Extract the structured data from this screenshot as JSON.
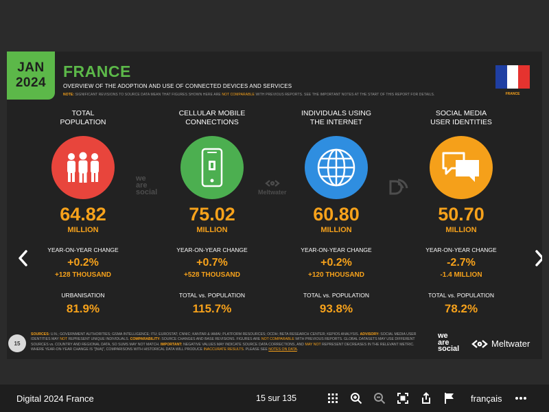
{
  "slide": {
    "date_badge": {
      "month": "JAN",
      "year": "2024"
    },
    "title": "FRANCE",
    "subtitle": "OVERVIEW OF THE ADOPTION AND USE OF CONNECTED DEVICES AND SERVICES",
    "note": {
      "label": "NOTE:",
      "text1": " SIGNIFICANT REVISIONS TO SOURCE DATA MEAN THAT FIGURES SHOWN HERE ARE ",
      "highlight": "NOT COMPARABLE",
      "text2": " WITH PREVIOUS REPORTS. SEE THE IMPORTANT NOTES AT THE START OF THIS REPORT FOR DETAILS."
    },
    "flag_label": "FRANCE",
    "colors": {
      "accent_orange": "#f7a21b",
      "accent_green": "#5cb849"
    },
    "columns": [
      {
        "heading": "TOTAL\nPOPULATION",
        "icon": "people-icon",
        "color": "#e8453c",
        "value": "64.82",
        "unit": "MILLION",
        "change_label": "YEAR-ON-YEAR CHANGE",
        "change_pct": "+0.2%",
        "change_abs": "+128 THOUSAND",
        "secondary_label": "URBANISATION",
        "secondary_value": "81.9%"
      },
      {
        "heading": "CELLULAR MOBILE\nCONNECTIONS",
        "icon": "mobile-phone-icon",
        "color": "#4caf50",
        "value": "75.02",
        "unit": "MILLION",
        "change_label": "YEAR-ON-YEAR CHANGE",
        "change_pct": "+0.7%",
        "change_abs": "+528 THOUSAND",
        "secondary_label": "TOTAL vs. POPULATION",
        "secondary_value": "115.7%"
      },
      {
        "heading": "INDIVIDUALS USING\nTHE INTERNET",
        "icon": "globe-icon",
        "color": "#2f8ee0",
        "value": "60.80",
        "unit": "MILLION",
        "change_label": "YEAR-ON-YEAR CHANGE",
        "change_pct": "+0.2%",
        "change_abs": "+120 THOUSAND",
        "secondary_label": "TOTAL vs. POPULATION",
        "secondary_value": "93.8%"
      },
      {
        "heading": "SOCIAL MEDIA\nUSER IDENTITIES",
        "icon": "speech-bubbles-icon",
        "color": "#f5a01a",
        "value": "50.70",
        "unit": "MILLION",
        "change_label": "YEAR-ON-YEAR CHANGE",
        "change_pct": "-2.7%",
        "change_abs": "-1.4 MILLION",
        "secondary_label": "TOTAL vs. POPULATION",
        "secondary_value": "78.2%"
      }
    ],
    "watermarks": {
      "we_are_social_1": "we",
      "we_are_social_2": "are",
      "we_are_social_3": "social",
      "meltwater": "Meltwater"
    },
    "page_number": "15",
    "sources": {
      "l1": "SOURCES:",
      "t1": " U.N.; GOVERNMENT AUTHORITIES; GSMA INTELLIGENCE; ITU; EUROSTAT; CNNIC; KANTAR & IAMAI; PLATFORM RESOURCES; OCDH; BETA RESEARCH CENTER; KEPIOS ANALYSIS. ",
      "l2": "ADVISORY:",
      "t2": " SOCIAL MEDIA USER IDENTITIES MAY ",
      "h2": "NOT",
      "t2b": " REPRESENT UNIQUE INDIVIDUALS. ",
      "l3": "COMPARABILITY:",
      "t3": " SOURCE CHANGES AND BASE REVISIONS. FIGURES ARE ",
      "h3": "NOT COMPARABLE",
      "t3b": " WITH PREVIOUS REPORTS. GLOBAL DATASETS MAY USE DIFFERENT SOURCES vs. COUNTRY AND REGIONAL DATA, SO SUMS MAY NOT MATCH. ",
      "l4": "IMPORTANT:",
      "t4": " NEGATIVE VALUES MAY INDICATE SOURCE DATA CORRECTIONS, AND ",
      "h4": "MAY NOT",
      "t4b": " REPRESENT DECREASES IN THE RELEVANT METRIC. WHERE YEAR-ON-YEAR CHANGE IS \"[N/A]\", COMPARISONS WITH HISTORICAL DATA WILL PRODUCE ",
      "h5": "INACCURATE RESULTS",
      "t5": ". PLEASE SEE ",
      "link": "NOTES ON DATA",
      "t6": "."
    },
    "footer_logos": {
      "ws1": "we",
      "ws2": "are",
      "ws3": "social",
      "meltwater": "Meltwater"
    }
  },
  "toolbar": {
    "doc_title": "Digital 2024 France",
    "page_counter": "15 sur 135",
    "language": "français"
  }
}
